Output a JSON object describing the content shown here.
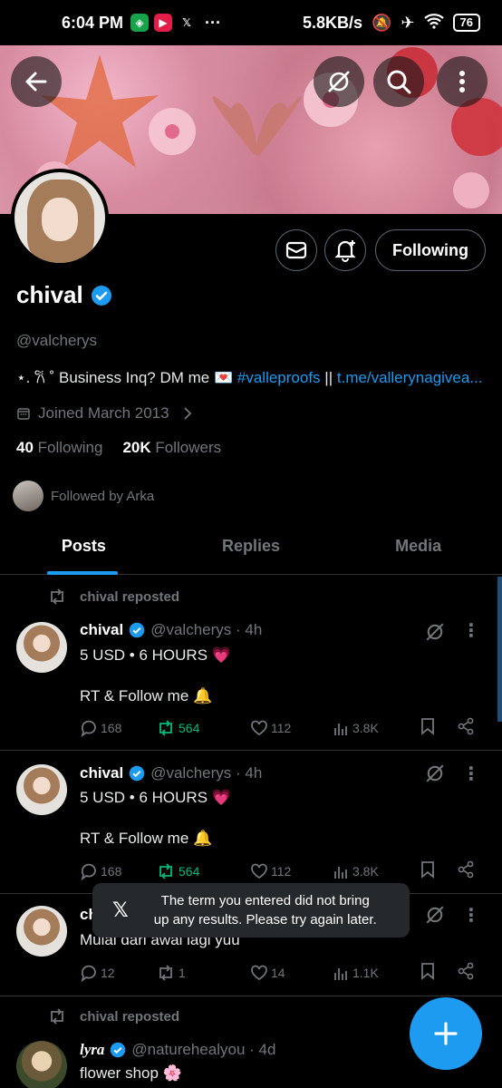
{
  "status_bar": {
    "time": "6:04 PM",
    "more": "···",
    "speed": "5.8KB/s",
    "battery": "76"
  },
  "profile": {
    "name": "chival",
    "handle": "@valcherys",
    "bio_prefix": "⋆. 𐙚 ˚ Business Inq? DM me 💌",
    "bio_hashtag": "#valleproofs",
    "bio_sep": "||",
    "bio_link": "t.me/vallerynagivea...",
    "joined": "Joined March 2013",
    "following_count": "40",
    "following_label": "Following",
    "followers_count": "20K",
    "followers_label": "Followers",
    "followed_by": "Followed by Arka",
    "following_button": "Following"
  },
  "tabs": [
    {
      "label": "Posts",
      "active": true
    },
    {
      "label": "Replies",
      "active": false
    },
    {
      "label": "Media",
      "active": false
    }
  ],
  "posts": [
    {
      "repost_label": "chival reposted",
      "name": "chival",
      "meta": "@valcherys · 4h",
      "line1": "5 USD • 6 HOURS 💗",
      "line2": "RT & Follow me 🔔",
      "replies": "168",
      "reposts": "564",
      "likes": "112",
      "views": "3.8K"
    },
    {
      "name": "chival",
      "meta": "@valcherys · 4h",
      "line1": "5 USD • 6 HOURS 💗",
      "line2": "RT & Follow me 🔔",
      "replies": "168",
      "reposts": "564",
      "likes": "112",
      "views": "3.8K"
    },
    {
      "name": "ch",
      "line1": "Mulai dari awal lagi yuu",
      "replies": "12",
      "reposts": "1",
      "likes": "14",
      "views": "1.1K"
    },
    {
      "repost_label": "chival reposted",
      "name": "lyra",
      "meta": "@naturehealyou · 4d",
      "line1": "flower shop 🌸"
    }
  ],
  "toast": {
    "message_line1": "The term you entered did not bring",
    "message_line2": "up any results. Please try again later."
  },
  "colors": {
    "accent": "#1d9bf0",
    "repost_green": "#00ba7c",
    "muted": "#71767b",
    "background": "#000000"
  }
}
